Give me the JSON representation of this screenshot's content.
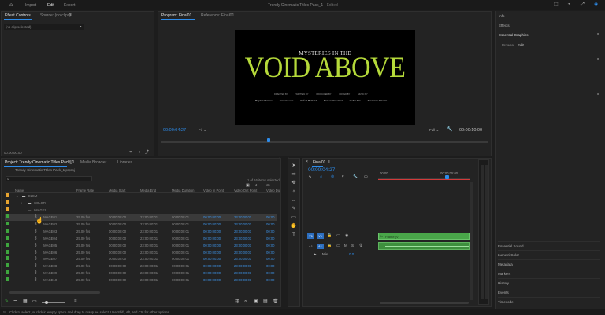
{
  "menu": {
    "home_icon": "home-icon",
    "tabs": [
      "Import",
      "Edit",
      "Export"
    ],
    "active_tab": "Edit",
    "title": "Trendy Cinematic Titles Pack_1",
    "title_sep": " - ",
    "edited": "Edited"
  },
  "effect_controls": {
    "tabs": [
      "Effect Controls",
      "Source: (no clips)"
    ],
    "no_clip": "(no clip selected)",
    "timecode": "00:00:00:00"
  },
  "program": {
    "tabs": [
      "Program: Final01",
      "Reference: Final01"
    ],
    "title_line1": "MYSTERIES IN THE",
    "title_line2": "VOID ABOVE",
    "credit_top": [
      "DIRECTED BY",
      "WRITTEN BY",
      "PRODUCED BY",
      "EDITED BY",
      "MUSIC BY"
    ],
    "credits": [
      "Hayden Herrera",
      "Everett Luna",
      "Rafael Holland",
      "Frances Rowland",
      "Colter Lin",
      "Savannah Vincent"
    ],
    "timecode": "00:00:04:27",
    "fit": "Fit",
    "full": "Full",
    "duration": "00:00:10:00"
  },
  "project": {
    "tabs": [
      "Project: Trendy Cinematic Titles Pack_1",
      "Media Browser",
      "Libraries"
    ],
    "path": "Trendy Cinematic Titles Pack_1.prproj",
    "items_selected": "1 of 16 items selected",
    "columns": [
      "Name",
      "Frame Rate",
      "Media Start",
      "Media End",
      "Media Duration",
      "Video In Point",
      "Video Out Point",
      "Video Du"
    ],
    "folders": [
      "ELEM",
      "COLOR",
      "IMAGES"
    ],
    "rows": [
      {
        "name": "IMAGE01",
        "fps": "25.00 fps",
        "start": "00:00:00:00",
        "end": "23:00:00:01",
        "dur": "00:00:00:01",
        "vin": "00:00:00:00",
        "vout": "23:00:00:01",
        "vdu": "00:00"
      },
      {
        "name": "IMAGE02",
        "fps": "25.00 fps",
        "start": "00:00:00:00",
        "end": "23:00:00:01",
        "dur": "00:00:00:01",
        "vin": "00:00:00:00",
        "vout": "23:00:00:01",
        "vdu": "00:00"
      },
      {
        "name": "IMAGE03",
        "fps": "25.00 fps",
        "start": "00:00:00:00",
        "end": "23:00:00:01",
        "dur": "00:00:00:01",
        "vin": "00:00:00:00",
        "vout": "23:00:00:01",
        "vdu": "00:00"
      },
      {
        "name": "IMAGE04",
        "fps": "25.00 fps",
        "start": "00:00:00:00",
        "end": "23:00:00:01",
        "dur": "00:00:00:01",
        "vin": "00:00:00:00",
        "vout": "23:00:00:01",
        "vdu": "00:00"
      },
      {
        "name": "IMAGE05",
        "fps": "25.00 fps",
        "start": "00:00:00:00",
        "end": "23:00:00:01",
        "dur": "00:00:00:01",
        "vin": "00:00:00:00",
        "vout": "23:00:00:01",
        "vdu": "00:00"
      },
      {
        "name": "IMAGE06",
        "fps": "25.00 fps",
        "start": "00:00:00:00",
        "end": "23:00:00:01",
        "dur": "00:00:00:01",
        "vin": "00:00:00:00",
        "vout": "23:00:00:01",
        "vdu": "00:00"
      },
      {
        "name": "IMAGE07",
        "fps": "25.00 fps",
        "start": "00:00:00:00",
        "end": "23:00:00:01",
        "dur": "00:00:00:01",
        "vin": "00:00:00:00",
        "vout": "23:00:00:01",
        "vdu": "00:00"
      },
      {
        "name": "IMAGE08",
        "fps": "25.00 fps",
        "start": "00:00:00:00",
        "end": "23:00:00:01",
        "dur": "00:00:00:01",
        "vin": "00:00:00:00",
        "vout": "23:00:00:01",
        "vdu": "00:00"
      },
      {
        "name": "IMAGE09",
        "fps": "25.00 fps",
        "start": "00:00:00:00",
        "end": "23:00:00:01",
        "dur": "00:00:00:01",
        "vin": "00:00:00:00",
        "vout": "23:00:00:01",
        "vdu": "00:00"
      },
      {
        "name": "IMAGE10",
        "fps": "25.00 fps",
        "start": "00:00:00:00",
        "end": "23:00:00:01",
        "dur": "00:00:00:01",
        "vin": "00:00:00:00",
        "vout": "23:00:00:01",
        "vdu": "00:00"
      }
    ]
  },
  "timeline": {
    "tab": "Final01",
    "timecode": "00:00:04:27",
    "ruler": [
      "00:00",
      "00:00:05:00"
    ],
    "tracks": [
      "V1",
      "A1",
      "Mix"
    ],
    "mix_value": "0.0",
    "clip_label": "Frame (V)"
  },
  "right_panel": {
    "top_items": [
      "Info",
      "Effects"
    ],
    "essential_graphics": "Essential Graphics",
    "eg_tabs": [
      "Browse",
      "Edit"
    ],
    "items": [
      "Essential Sound",
      "Lumetri Color",
      "Metadata",
      "Markers",
      "History",
      "Events",
      "Timecode"
    ]
  },
  "status_bar": {
    "text": "Click to select, or click in empty space and drag to marquee select. Use Shift, Alt, and Ctrl for other options."
  },
  "colors": {
    "accent_blue": "#2d8ceb",
    "title_green": "#b5d93a",
    "clip_green": "#49a649",
    "playhead_red": "#d23a3a"
  }
}
